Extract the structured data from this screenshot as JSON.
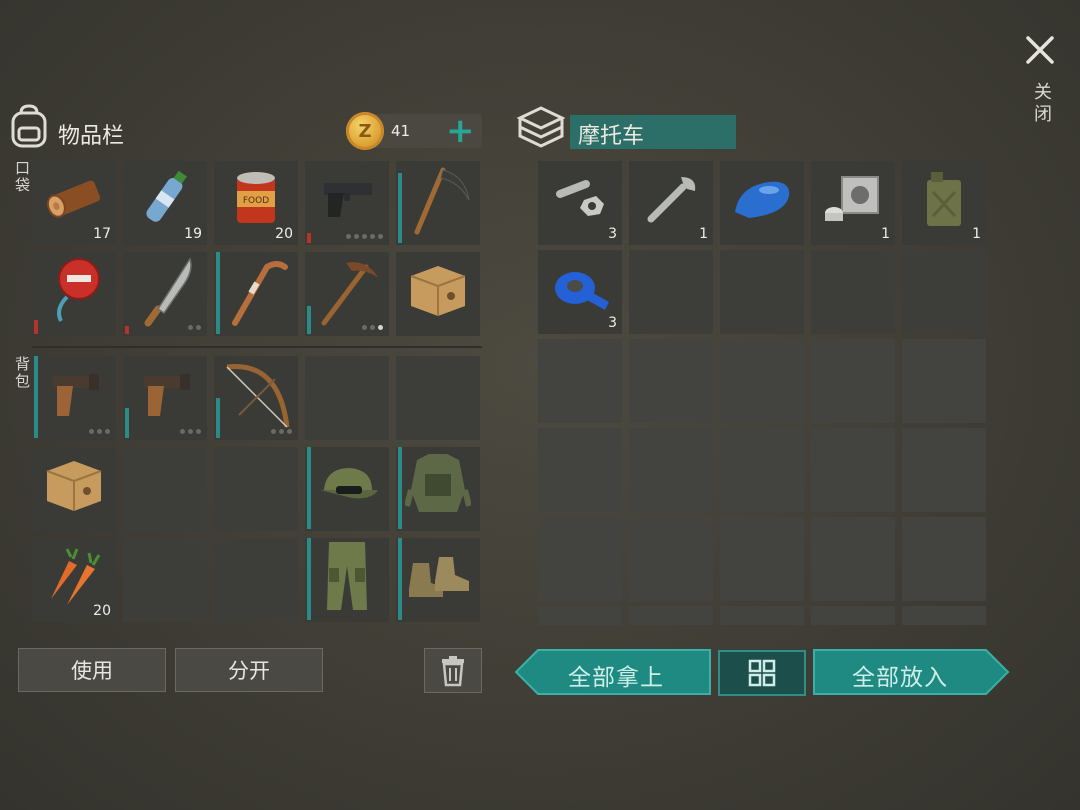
{
  "close": {
    "icon": "close-icon",
    "label": "关闭"
  },
  "inventory": {
    "title": "物品栏",
    "coins": "41",
    "pocket_label": "口袋",
    "backpack_label": "背包",
    "pocket_items": [
      {
        "name": "log",
        "qty": "17"
      },
      {
        "name": "water-bottle",
        "qty": "19"
      },
      {
        "name": "food-can",
        "qty": "20"
      },
      {
        "name": "pistol",
        "qty": ""
      },
      {
        "name": "scythe",
        "qty": ""
      },
      {
        "name": "stop-sign",
        "qty": ""
      },
      {
        "name": "machete",
        "qty": ""
      },
      {
        "name": "hockey-stick",
        "qty": ""
      },
      {
        "name": "pickaxe",
        "qty": ""
      },
      {
        "name": "cardboard-box",
        "qty": ""
      }
    ],
    "backpack_items": [
      {
        "name": "flare-gun",
        "qty": ""
      },
      {
        "name": "flare-gun",
        "qty": ""
      },
      {
        "name": "bow",
        "qty": ""
      },
      {
        "name": "empty",
        "qty": ""
      },
      {
        "name": "empty",
        "qty": ""
      },
      {
        "name": "cardboard-box",
        "qty": ""
      },
      {
        "name": "empty",
        "qty": ""
      },
      {
        "name": "empty",
        "qty": ""
      },
      {
        "name": "camo-cap",
        "qty": ""
      },
      {
        "name": "tactical-vest",
        "qty": ""
      },
      {
        "name": "carrots",
        "qty": "20"
      },
      {
        "name": "empty",
        "qty": ""
      },
      {
        "name": "empty",
        "qty": ""
      },
      {
        "name": "camo-pants",
        "qty": ""
      },
      {
        "name": "boots",
        "qty": ""
      }
    ],
    "use_label": "使用",
    "split_label": "分开"
  },
  "storage": {
    "title": "摩托车",
    "items": [
      {
        "name": "bolts",
        "qty": "3"
      },
      {
        "name": "wrench",
        "qty": "1"
      },
      {
        "name": "fuel-tank",
        "qty": ""
      },
      {
        "name": "engine-cylinder",
        "qty": "1"
      },
      {
        "name": "jerry-can",
        "qty": "1"
      },
      {
        "name": "duct-tape",
        "qty": "3"
      }
    ],
    "take_all_label": "全部拿上",
    "put_all_label": "全部放入"
  },
  "colors": {
    "accent": "#1f8a82",
    "durability_teal": "#2a8b88",
    "durability_red": "#b3342a"
  }
}
